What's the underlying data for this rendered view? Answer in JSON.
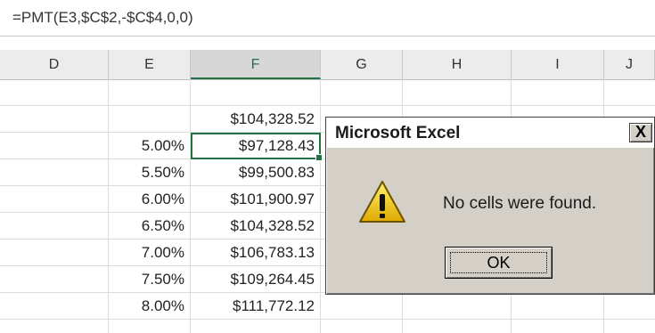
{
  "formula_bar": {
    "formula": "=PMT(E3,$C$2,-$C$4,0,0)"
  },
  "columns": [
    {
      "label": "D",
      "selected": false
    },
    {
      "label": "E",
      "selected": false
    },
    {
      "label": "F",
      "selected": true
    },
    {
      "label": "G",
      "selected": false
    },
    {
      "label": "H",
      "selected": false
    },
    {
      "label": "I",
      "selected": false
    },
    {
      "label": "J",
      "selected": false
    }
  ],
  "rows": [
    {
      "rate": "",
      "payment": ""
    },
    {
      "rate": "",
      "payment": "$104,328.52"
    },
    {
      "rate": "5.00%",
      "payment": "$97,128.43",
      "active": true
    },
    {
      "rate": "5.50%",
      "payment": "$99,500.83"
    },
    {
      "rate": "6.00%",
      "payment": "$101,900.97"
    },
    {
      "rate": "6.50%",
      "payment": "$104,328.52"
    },
    {
      "rate": "7.00%",
      "payment": "$106,783.13"
    },
    {
      "rate": "7.50%",
      "payment": "$109,264.45"
    },
    {
      "rate": "8.00%",
      "payment": "$111,772.12"
    }
  ],
  "dialog": {
    "title": "Microsoft Excel",
    "close_label": "X",
    "message": "No cells were found.",
    "ok_label": "OK",
    "icon": "warning-icon"
  },
  "colors": {
    "accent": "#217346",
    "dialog_bg": "#d4d0c8"
  }
}
